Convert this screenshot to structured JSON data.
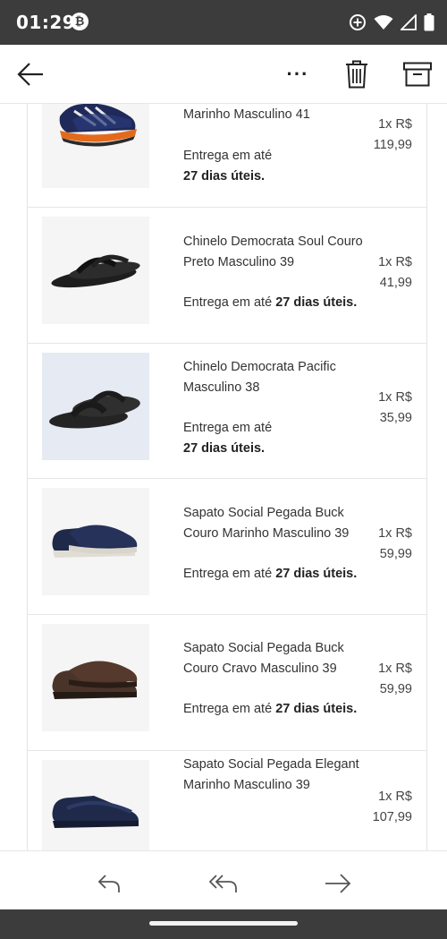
{
  "status_bar": {
    "time": "01:29",
    "badge_icon": "crypto-badge-icon",
    "icons": [
      "add-circle-icon",
      "wifi-icon",
      "signal-icon",
      "battery-icon"
    ]
  },
  "app_bar": {
    "icons": [
      "back-arrow-icon",
      "more-icon",
      "trash-icon",
      "archive-icon"
    ],
    "more_glyph": "···"
  },
  "items": [
    {
      "name": "Marinho Masculino 41",
      "qty_price": "1x R$",
      "price": "119,99",
      "delivery_prefix": "Entrega em até",
      "delivery_days": "27 dias úteis.",
      "image": "running-shoe"
    },
    {
      "name": "Chinelo Democrata Soul Couro Preto Masculino 39",
      "qty_price": "1x R$",
      "price": "41,99",
      "delivery_prefix": "Entrega em até",
      "delivery_days": "27 dias úteis.",
      "image": "black-sandal"
    },
    {
      "name": "Chinelo Democrata Pacific Masculino 38",
      "qty_price": "1x R$",
      "price": "35,99",
      "delivery_prefix": "Entrega em até",
      "delivery_days": "27 dias úteis.",
      "image": "dark-sandal"
    },
    {
      "name": "Sapato Social Pegada Buck Couro Marinho Masculino 39",
      "qty_price": "1x R$",
      "price": "59,99",
      "delivery_prefix": "Entrega em até",
      "delivery_days": "27 dias úteis.",
      "image": "navy-derby"
    },
    {
      "name": "Sapato Social Pegada Buck Couro Cravo Masculino 39",
      "qty_price": "1x R$",
      "price": "59,99",
      "delivery_prefix": "Entrega em até",
      "delivery_days": "27 dias úteis.",
      "image": "brown-derby"
    },
    {
      "name": "Sapato Social Pegada Elegant Marinho Masculino 39",
      "qty_price": "1x R$",
      "price": "107,99",
      "delivery_prefix": "",
      "delivery_days": "",
      "image": "navy-loafer"
    }
  ],
  "bottom_bar": {
    "icons": [
      "reply-icon",
      "reply-all-icon",
      "forward-icon"
    ]
  },
  "colors": {
    "system_bar": "#3c3c3c",
    "divider": "#e6e6e6",
    "text": "#333333",
    "shoe_navy": "#1f2a4a",
    "shoe_brown": "#4a342a",
    "shoe_black": "#2b2b2b"
  }
}
